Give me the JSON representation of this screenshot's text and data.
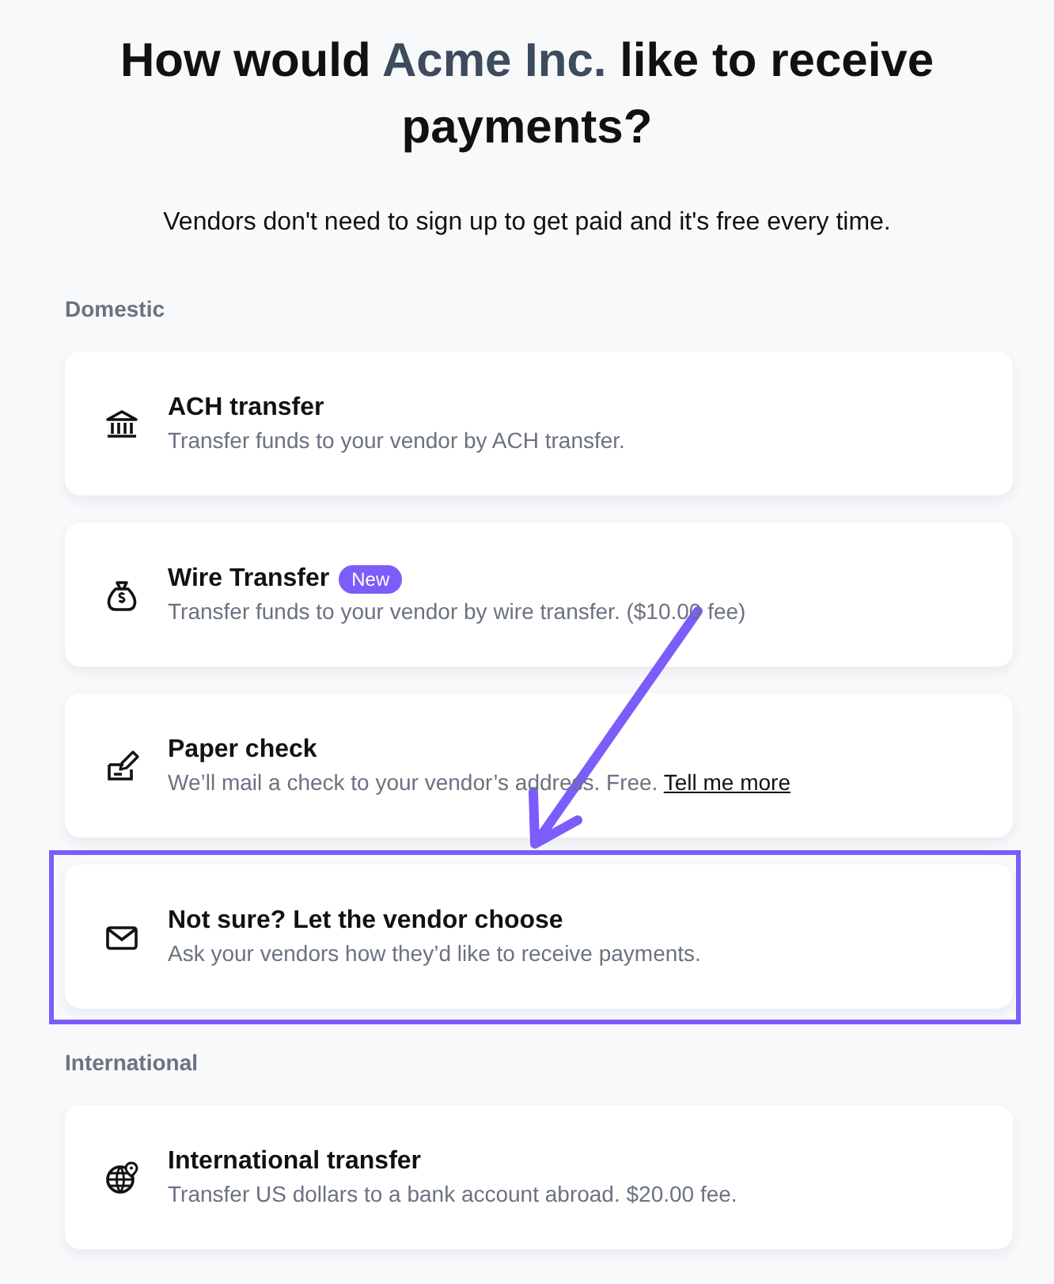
{
  "title": {
    "before": "How would",
    "company": "Acme Inc.",
    "after": "like to receive payments?"
  },
  "subtitle": "Vendors don't need to sign up to get paid and it's free every time.",
  "groups": [
    {
      "heading": "Domestic",
      "options": [
        {
          "title": "ACH transfer",
          "description": "Transfer funds to your vendor by ACH transfer.",
          "highlighted": false
        },
        {
          "title": "Wire Transfer",
          "badge": "New",
          "description": "Transfer funds to your vendor by wire transfer. ($10.00 fee)",
          "highlighted": false
        },
        {
          "title": "Paper check",
          "description": "We’ll mail a check to your vendor’s address. Free.",
          "link": "Tell me more",
          "highlighted": false
        },
        {
          "title": "Not sure? Let the vendor choose",
          "description": "Ask your vendors how they’d like to receive payments.",
          "highlighted": true
        }
      ]
    },
    {
      "heading": "International",
      "options": [
        {
          "title": "International transfer",
          "description": "Transfer US dollars to a bank account abroad. $20.00 fee.",
          "highlighted": false
        }
      ]
    }
  ]
}
